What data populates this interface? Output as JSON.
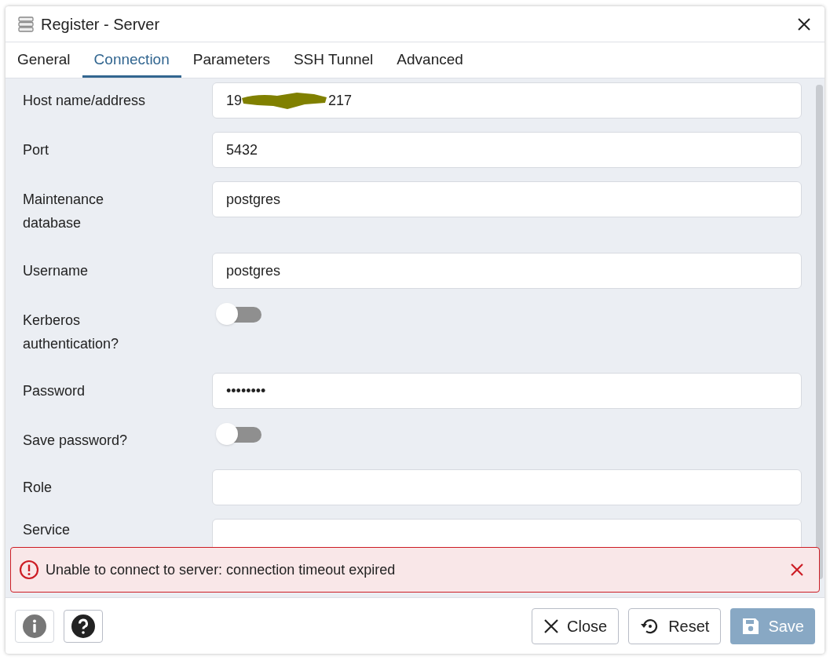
{
  "window": {
    "title": "Register - Server"
  },
  "tabs": [
    {
      "label": "General",
      "selected": false
    },
    {
      "label": "Connection",
      "selected": true
    },
    {
      "label": "Parameters",
      "selected": false
    },
    {
      "label": "SSH Tunnel",
      "selected": false
    },
    {
      "label": "Advanced",
      "selected": false
    }
  ],
  "fields": [
    {
      "kind": "text",
      "label": "Host name/address",
      "value_start": "19",
      "value_end": "217",
      "redacted": true
    },
    {
      "kind": "text",
      "label": "Port",
      "value_start": "5432"
    },
    {
      "kind": "text",
      "label": "Maintenance database",
      "value_start": "postgres"
    },
    {
      "kind": "text",
      "label": "Username",
      "value_start": "postgres"
    },
    {
      "kind": "toggle",
      "label": "Kerberos authentication?",
      "on": false
    },
    {
      "kind": "password",
      "label": "Password",
      "value_start": "••••••••"
    },
    {
      "kind": "toggle",
      "label": "Save password?",
      "on": false
    },
    {
      "kind": "text",
      "label": "Role"
    },
    {
      "kind": "text",
      "label": "Service"
    }
  ],
  "error": {
    "message": "Unable to connect to server: connection timeout expired"
  },
  "buttons": [
    {
      "label": "Close",
      "disabled": false
    },
    {
      "label": "Reset",
      "disabled": false
    },
    {
      "label": "Save",
      "disabled": true
    }
  ]
}
